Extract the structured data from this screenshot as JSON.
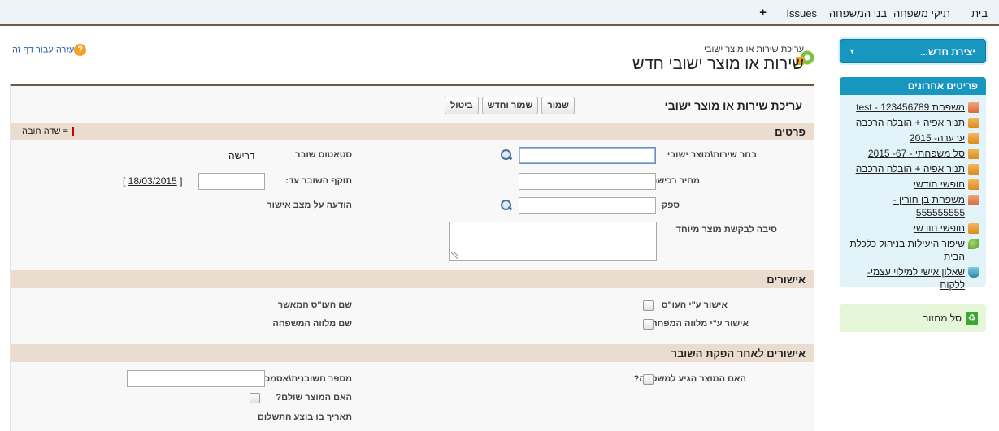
{
  "nav": {
    "home": "בית",
    "family_files": "תיקי משפחה",
    "family_members": "בני המשפחה",
    "issues": "Issues",
    "plus": "+"
  },
  "sidebar": {
    "create_new": "יצירת חדש...",
    "recent_title": "פריטים אחרונים",
    "recent_items": [
      {
        "label": "משפחת test - 123456789",
        "icon": "box-icon"
      },
      {
        "label": "תנור אפיה + הובלה הרכבה",
        "icon": "box-icon"
      },
      {
        "label": "ערערה- 2015",
        "icon": "box-icon"
      },
      {
        "label": "סל משפחתי - 67- 2015",
        "icon": "box-icon"
      },
      {
        "label": "תנור אפיה + הובלה הרכבה",
        "icon": "box-icon"
      },
      {
        "label": "חופשי חודשי",
        "icon": "box-icon"
      },
      {
        "label": "משפחת בן חורין - 555555555",
        "icon": "box-icon"
      },
      {
        "label": "חופשי חודשי",
        "icon": "box-icon"
      },
      {
        "label": "שיפור היעילות בניהול כלכלת הבית",
        "icon": "leaf-icon"
      },
      {
        "label": "שאלון אישי למילוי עצמי- ללקוח",
        "icon": "cup-icon"
      }
    ],
    "recycle_bin": "סל מחזור"
  },
  "header": {
    "help": "עזרה עבור דף זה",
    "subtitle": "עריכת שירות או מוצר ישובי",
    "title": "שירות או מוצר ישובי חדש"
  },
  "panel": {
    "title": "עריכת שירות או מוצר ישובי",
    "buttons": {
      "save": "שמור",
      "save_new": "שמור וחדש",
      "cancel": "ביטול"
    },
    "required_legend": "= שדה חובה",
    "sections": {
      "details": "פרטים",
      "approvals": "אישורים",
      "post_voucher": "אישורים לאחר הפקת השובר"
    },
    "fields": {
      "choose_service": "בחר שירות\\מוצר ישובי",
      "purchase_price": "מחיר רכישה",
      "supplier": "ספק",
      "special_reason": "סיבה לבקשת מוצר מיוחד",
      "voucher_status": "סטאטוס שובר",
      "voucher_status_value": "דרישה",
      "voucher_valid_until": "תוקף השובר עד:",
      "voucher_date_link": "18/03/2015",
      "approval_notice": "הודעה על מצב אישור",
      "social_worker_approval": "אישור ע\"י העו\"ס",
      "family_escort_approval": "אישור ע\"י מלווה המפחה",
      "approving_social_worker": "שם העו\"ס המאשר",
      "family_escort_name": "שם מלווה המשפחה",
      "product_arrived": "האם המוצר הגיע למשפחה?",
      "invoice_number": "מספר חשובנית\\אסמכתא",
      "product_paid": "האם המוצר שולם?",
      "payment_date": "תאריך בו בוצע התשלום"
    }
  }
}
